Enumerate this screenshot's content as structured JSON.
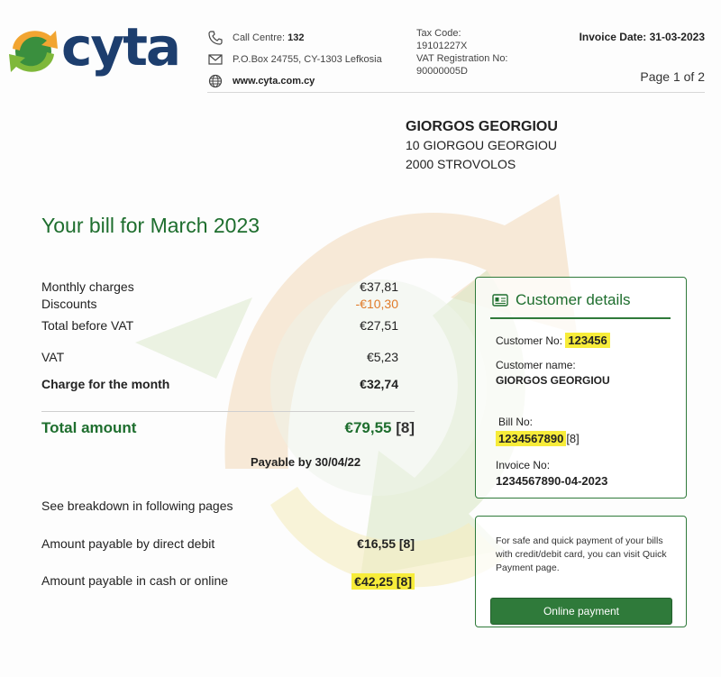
{
  "header": {
    "brand": "cyta",
    "call_centre_label": "Call Centre:",
    "call_centre_number": "132",
    "po_box": "P.O.Box 24755, CY-1303 Lefkosia",
    "website": "www.cyta.com.cy",
    "tax_code_label": "Tax Code:",
    "tax_code": "19101227X",
    "vat_label": "VAT Registration No:",
    "vat_number": "90000005D",
    "invoice_date": "Invoice Date: 31-03-2023",
    "page": "Page 1 of 2"
  },
  "recipient": {
    "name": "GIORGOS GEORGIOU",
    "street": "10 GIORGOU GEORGIOU",
    "city": "2000 STROVOLOS"
  },
  "bill": {
    "title": "Your bill for March 2023",
    "lines": [
      {
        "label": "Monthly charges",
        "value": "€37,81"
      },
      {
        "label": "Discounts",
        "value": "-€10,30"
      },
      {
        "label": "Total before VAT",
        "value": "€27,51"
      },
      {
        "label": "VAT",
        "value": "€5,23"
      },
      {
        "label": "Charge for the month",
        "value": "€32,74"
      }
    ],
    "total_label": "Total amount",
    "total_value": "€79,55",
    "total_ref": "[8]",
    "payable_by": "Payable by 30/04/22",
    "breakdown_note": "See breakdown in following pages",
    "direct_debit_label": "Amount payable by direct debit",
    "direct_debit_value": "€16,55 [8]",
    "cash_label": "Amount payable in cash or online",
    "cash_value": "€42,25 [8]"
  },
  "customer": {
    "title": "Customer details",
    "customer_no_label": "Customer No:",
    "customer_no": "123456",
    "customer_name_label": "Customer name:",
    "customer_name": "GIORGOS GEORGIOU",
    "bill_no_label": "Bill No:",
    "bill_no": "1234567890",
    "bill_no_ref": "[8]",
    "invoice_no_label": "Invoice No:",
    "invoice_no": "1234567890-04-2023"
  },
  "payment": {
    "text": "For safe and quick payment of your bills with credit/debit card, you can visit Quick Payment page.",
    "button_label": "Online payment"
  },
  "colors": {
    "brand_green": "#1e6e2e",
    "brand_navy": "#1d3e6e",
    "highlight": "#f7ec3a",
    "discount_orange": "#e07b2a"
  }
}
